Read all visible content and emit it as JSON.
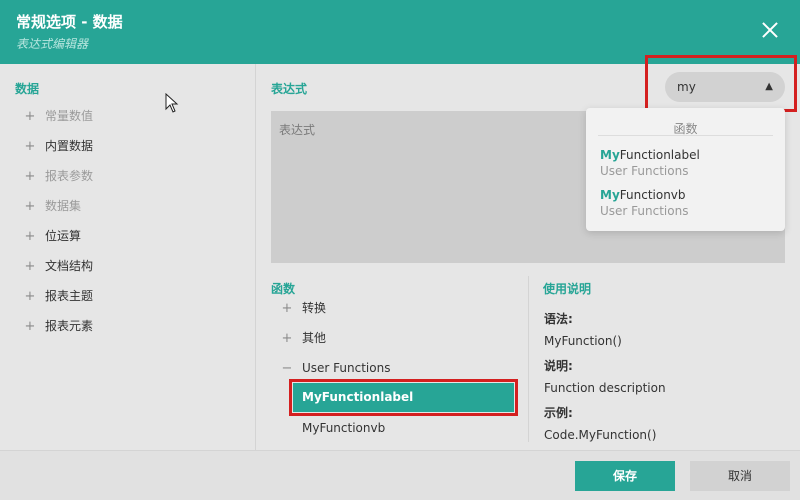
{
  "dialog": {
    "title": "常规选项 - 数据",
    "subtitle": "表达式编辑器"
  },
  "left_panel": {
    "title": "数据",
    "items": [
      {
        "label": "常量数值",
        "enabled": false
      },
      {
        "label": "内置数据",
        "enabled": true
      },
      {
        "label": "报表参数",
        "enabled": false
      },
      {
        "label": "数据集",
        "enabled": false
      },
      {
        "label": "位运算",
        "enabled": true
      },
      {
        "label": "文档结构",
        "enabled": true
      },
      {
        "label": "报表主题",
        "enabled": true
      },
      {
        "label": "报表元素",
        "enabled": true
      }
    ]
  },
  "expression": {
    "title": "表达式",
    "placeholder": "表达式"
  },
  "search": {
    "value": "my"
  },
  "dropdown": {
    "header": "函数",
    "options": [
      {
        "match": "My",
        "rest": "Functionlabel",
        "category": "User Functions"
      },
      {
        "match": "My",
        "rest": "Functionvb",
        "category": "User Functions"
      }
    ]
  },
  "functions": {
    "title": "函数",
    "items": [
      {
        "label": "转换",
        "expander": "+"
      },
      {
        "label": "其他",
        "expander": "+"
      },
      {
        "label": "User Functions",
        "expander": "−"
      }
    ],
    "children": [
      {
        "label": "MyFunctionlabel",
        "selected": true
      },
      {
        "label": "MyFunctionvb",
        "selected": false
      }
    ]
  },
  "help": {
    "title": "使用说明",
    "syntax_label": "语法:",
    "syntax": "MyFunction()",
    "desc_label": "说明:",
    "desc": "Function description",
    "example_label": "示例:",
    "example": "Code.MyFunction()"
  },
  "footer": {
    "save": "保存",
    "cancel": "取消"
  },
  "colors": {
    "accent": "#27a596",
    "highlight_box": "#d42020"
  }
}
